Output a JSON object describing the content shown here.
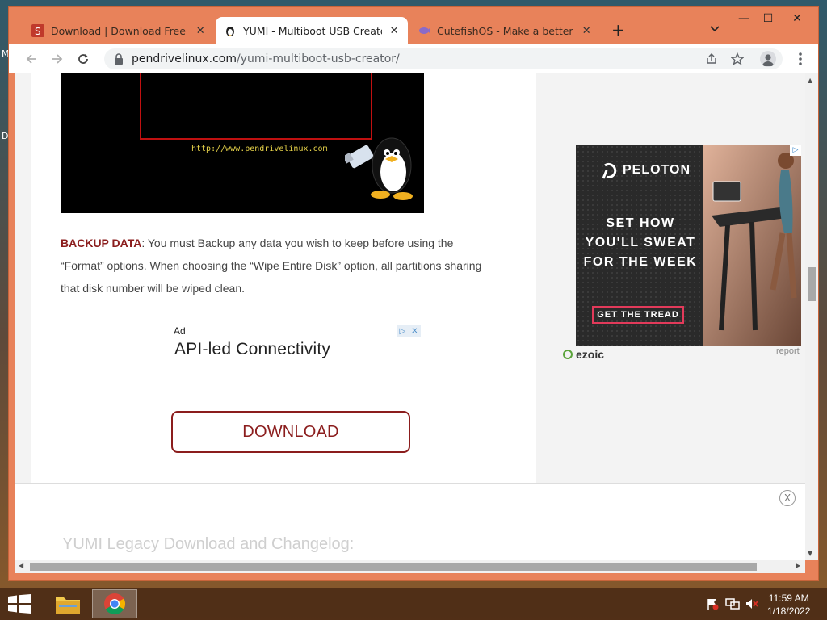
{
  "desktop": {
    "edge_letters": [
      "M",
      "D"
    ]
  },
  "tabs": [
    {
      "title": "Download | Download Free Softw",
      "favicon": "softpedia-icon",
      "active": false
    },
    {
      "title": "YUMI - Multiboot USB Creator | P",
      "favicon": "tux-icon",
      "active": true
    },
    {
      "title": "CutefishOS - Make a better Desk",
      "favicon": "cutefish-icon",
      "active": false
    }
  ],
  "tab_close": "✕",
  "new_tab": "+",
  "window_controls": {
    "minimize": "—",
    "maximize": "☐",
    "close": "✕"
  },
  "address_bar": {
    "domain": "pendrivelinux.com",
    "path": "/yumi-multiboot-usb-creator/"
  },
  "page": {
    "image_url_text": "http://www.pendrivelinux.com",
    "backup_lead": "BACKUP DATA",
    "backup_text": ": You must Backup any data you wish to keep before using the “Format” options. When choosing the “Wipe Entire Disk” option, all partitions sharing that disk number will be wiped clean.",
    "ad_label": "Ad",
    "ad_headline": "API-led Connectivity",
    "download_label": "DOWNLOAD",
    "legacy_heading": "YUMI Legacy Download and Changelog:",
    "sticky_close": "X"
  },
  "side_ad": {
    "brand": "PELOTON",
    "copy_lines": [
      "SET HOW",
      "YOU'LL SWEAT",
      "FOR THE WEEK"
    ],
    "cta": "GET THE TREAD",
    "network": "ezoic",
    "report": "report"
  },
  "taskbar": {
    "time": "11:59 AM",
    "date": "1/18/2022"
  },
  "colors": {
    "brand": "#8b1d1d",
    "chrome_frame": "#e8825a",
    "peloton_accent": "#e23a5a"
  }
}
